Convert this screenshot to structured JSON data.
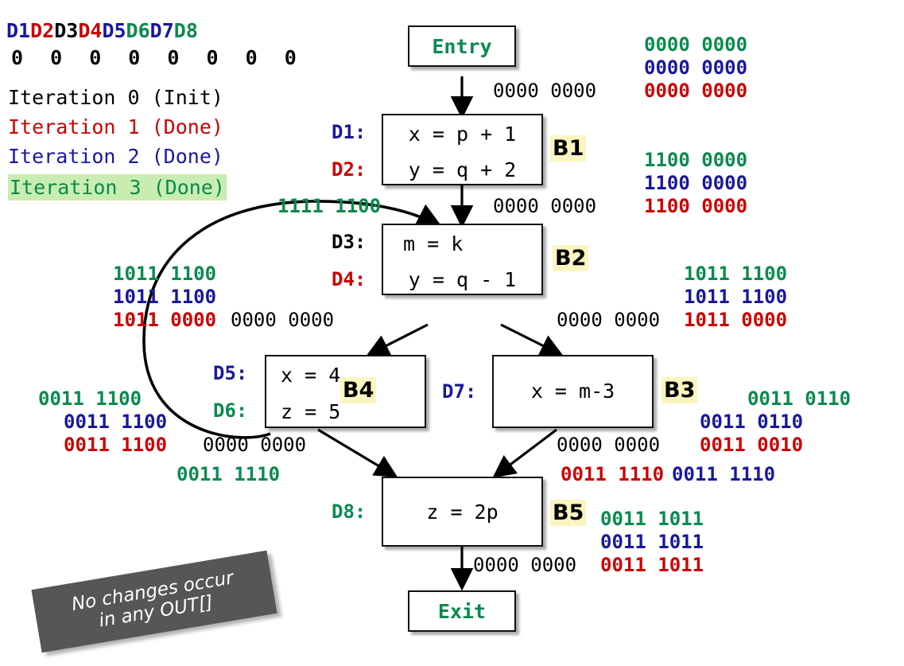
{
  "legend": {
    "defs": [
      {
        "name": "D1",
        "color": "#18189c"
      },
      {
        "name": "D2",
        "color": "#cc0000"
      },
      {
        "name": "D3",
        "color": "#000000"
      },
      {
        "name": "D4",
        "color": "#cc0000"
      },
      {
        "name": "D5",
        "color": "#18189c"
      },
      {
        "name": "D6",
        "color": "#0a8a4e"
      },
      {
        "name": "D7",
        "color": "#18189c"
      },
      {
        "name": "D8",
        "color": "#0a8a4e"
      }
    ],
    "bits_row": "0 0 0 0 0 0 0 0",
    "iterations": [
      {
        "label": "Iteration 0 (Init)",
        "color": "#000000",
        "highlight": false
      },
      {
        "label": "Iteration 1 (Done)",
        "color": "#cc0000",
        "highlight": false
      },
      {
        "label": "Iteration 2 (Done)",
        "color": "#18189c",
        "highlight": false
      },
      {
        "label": "Iteration 3 (Done)",
        "color": "#0a8a4e",
        "highlight": true
      }
    ],
    "highlight_color": "#c9edb0"
  },
  "nodes": {
    "entry": {
      "label": "Entry"
    },
    "exit": {
      "label": "Exit"
    },
    "b1": {
      "tag": "B1",
      "stmts": [
        "x = p + 1",
        "y = q + 2"
      ],
      "defs": [
        "D1:",
        "D2:"
      ],
      "def_colors": [
        "#18189c",
        "#cc0000"
      ]
    },
    "b2": {
      "tag": "B2",
      "stmts": [
        "m = k",
        "y = q - 1"
      ],
      "defs": [
        "D3:",
        "D4:"
      ],
      "def_colors": [
        "#000000",
        "#cc0000"
      ]
    },
    "b4": {
      "tag": "B4",
      "stmts": [
        "x = 4",
        "z = 5"
      ],
      "defs": [
        "D5:",
        "D6:"
      ],
      "def_colors": [
        "#18189c",
        "#0a8a4e"
      ]
    },
    "b3": {
      "tag": "B3",
      "stmts": [
        "x = m-3"
      ],
      "defs": [
        "D7:"
      ],
      "def_colors": [
        "#18189c"
      ]
    },
    "b5": {
      "tag": "B5",
      "stmts": [
        "z = 2p"
      ],
      "defs": [
        "D8:"
      ],
      "def_colors": [
        "#0a8a4e"
      ]
    },
    "tag_bg": "#fbf5c0"
  },
  "bitvectors": {
    "entry_out_black": "0000 0000",
    "b1_in_green": "0000 0000",
    "b1_in_blue": "0000 0000",
    "b1_in_red": "0000 0000",
    "b1_in_black": "0000 0000",
    "b1_out_green": "1100 0000",
    "b1_out_blue": "1100 0000",
    "b1_out_red": "1100 0000",
    "b1_out_black": "0000 0000",
    "backedge_green": "1111 1100",
    "b2_in_green": "1011 1100",
    "b2_in_blue": "1011 1100",
    "b2_in_red": "1011 0000",
    "b2_out_green": "1011 1100",
    "b2_out_blue": "1011 1100",
    "b2_out_red": "1011 0000",
    "b2_edge_black_left": "0000 0000",
    "b2_edge_black_right": "0000 0000",
    "b4_green": "0011 1100",
    "b4_blue": "0011 1100",
    "b4_red": "0011 1100",
    "b4_black": "0000 0000",
    "b4_out_green": "0011 1110",
    "b3_green": "0011 0110",
    "b3_blue": "0011 0110",
    "b3_red": "0011 0010",
    "b3_black": "0000 0000",
    "b5_in_red": "0011 1110",
    "b5_in_blue": "0011 1110",
    "b5_out_green": "0011 1011",
    "b5_out_blue": "0011 1011",
    "b5_out_red": "0011 1011",
    "b5_exit_black": "0000 0000"
  },
  "banner": {
    "line1": "No changes occur",
    "line2": "in any OUT[]",
    "bg": "#565656",
    "fg": "#ffffff"
  }
}
